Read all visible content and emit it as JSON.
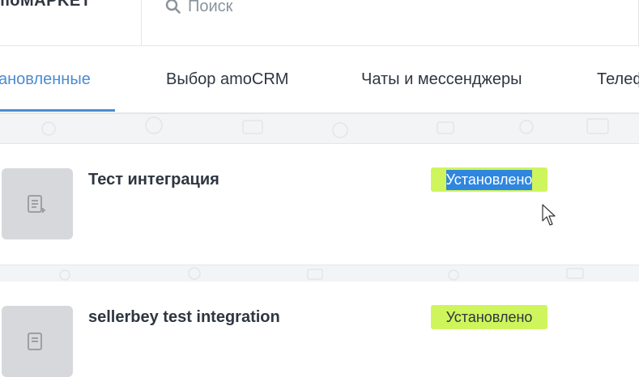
{
  "header": {
    "brand": "moMAPKET",
    "search_placeholder": "Поиск"
  },
  "tabs": [
    {
      "label": "ановленные",
      "active": true
    },
    {
      "label": "Выбор amoCRM",
      "active": false
    },
    {
      "label": "Чаты и мессенджеры",
      "active": false
    },
    {
      "label": "Телеф",
      "active": false
    }
  ],
  "integrations": [
    {
      "title": "Тест интеграция",
      "status": "Установлено",
      "status_selected": true
    },
    {
      "title": "sellerbey test integration",
      "status": "Установлено",
      "status_selected": false
    }
  ],
  "colors": {
    "accent": "#4c8bd2",
    "status_badge": "#cff55c",
    "selection": "#2f86e0"
  }
}
